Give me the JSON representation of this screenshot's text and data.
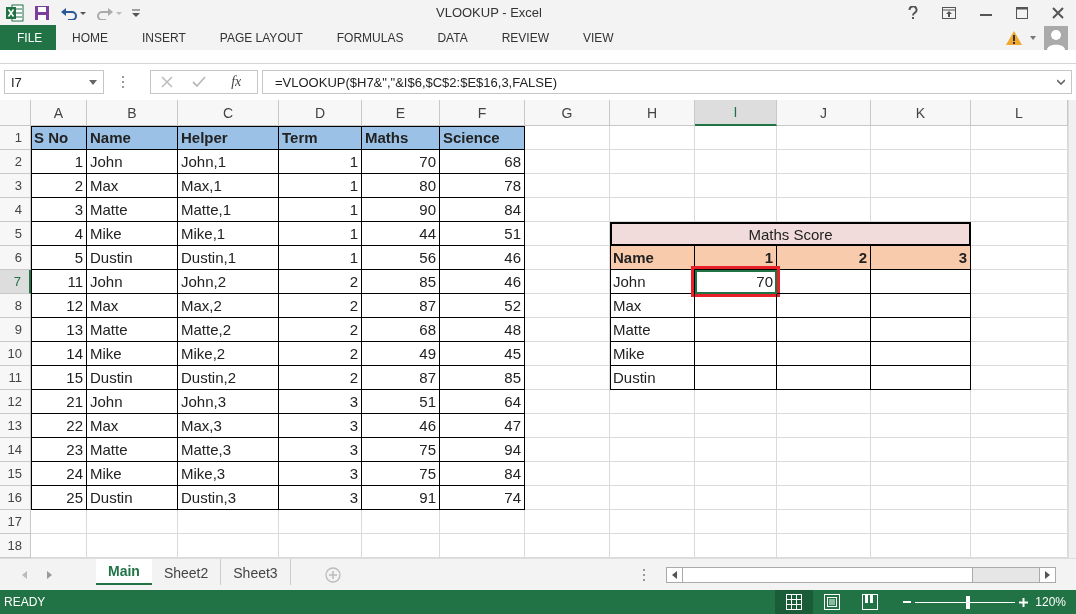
{
  "window": {
    "title": "VLOOKUP - Excel"
  },
  "ribbon_tabs": [
    {
      "label": "FILE",
      "kind": "file"
    },
    {
      "label": "HOME",
      "kind": "tab"
    },
    {
      "label": "INSERT",
      "kind": "tab"
    },
    {
      "label": "PAGE LAYOUT",
      "kind": "tab"
    },
    {
      "label": "FORMULAS",
      "kind": "tab"
    },
    {
      "label": "DATA",
      "kind": "tab"
    },
    {
      "label": "REVIEW",
      "kind": "tab"
    },
    {
      "label": "VIEW",
      "kind": "tab"
    }
  ],
  "formula_bar": {
    "name_box": "I7",
    "function_label": "fx",
    "formula": "=VLOOKUP($H7&\",\"&I$6,$C$2:$E$16,3,FALSE)"
  },
  "sheet": {
    "columns": [
      {
        "label": "A",
        "selected": false
      },
      {
        "label": "B",
        "selected": false
      },
      {
        "label": "C",
        "selected": false
      },
      {
        "label": "D",
        "selected": false
      },
      {
        "label": "E",
        "selected": false
      },
      {
        "label": "F",
        "selected": false
      },
      {
        "label": "G",
        "selected": false
      },
      {
        "label": "H",
        "selected": false
      },
      {
        "label": "I",
        "selected": true
      },
      {
        "label": "J",
        "selected": false
      },
      {
        "label": "K",
        "selected": false
      },
      {
        "label": "L",
        "selected": false
      }
    ],
    "rows": [
      {
        "label": "1",
        "selected": false
      },
      {
        "label": "2",
        "selected": false
      },
      {
        "label": "3",
        "selected": false
      },
      {
        "label": "4",
        "selected": false
      },
      {
        "label": "5",
        "selected": false
      },
      {
        "label": "6",
        "selected": false
      },
      {
        "label": "7",
        "selected": true
      },
      {
        "label": "8",
        "selected": false
      },
      {
        "label": "9",
        "selected": false
      },
      {
        "label": "10",
        "selected": false
      },
      {
        "label": "11",
        "selected": false
      },
      {
        "label": "12",
        "selected": false
      },
      {
        "label": "13",
        "selected": false
      },
      {
        "label": "14",
        "selected": false
      },
      {
        "label": "15",
        "selected": false
      },
      {
        "label": "16",
        "selected": false
      },
      {
        "label": "17",
        "selected": false
      },
      {
        "label": "18",
        "selected": false
      }
    ]
  },
  "source_table": {
    "columns": [
      {
        "label": "S No",
        "kind": "number"
      },
      {
        "label": "Name",
        "kind": "text"
      },
      {
        "label": "Helper",
        "kind": "text"
      },
      {
        "label": "Term",
        "kind": "number"
      },
      {
        "label": "Maths",
        "kind": "number"
      },
      {
        "label": "Science",
        "kind": "number"
      }
    ],
    "rows": [
      [
        "1",
        "John",
        "John,1",
        "1",
        "70",
        "68"
      ],
      [
        "2",
        "Max",
        "Max,1",
        "1",
        "80",
        "78"
      ],
      [
        "3",
        "Matte",
        "Matte,1",
        "1",
        "90",
        "84"
      ],
      [
        "4",
        "Mike",
        "Mike,1",
        "1",
        "44",
        "51"
      ],
      [
        "5",
        "Dustin",
        "Dustin,1",
        "1",
        "56",
        "46"
      ],
      [
        "11",
        "John",
        "John,2",
        "2",
        "85",
        "46"
      ],
      [
        "12",
        "Max",
        "Max,2",
        "2",
        "87",
        "52"
      ],
      [
        "13",
        "Matte",
        "Matte,2",
        "2",
        "68",
        "48"
      ],
      [
        "14",
        "Mike",
        "Mike,2",
        "2",
        "49",
        "45"
      ],
      [
        "15",
        "Dustin",
        "Dustin,2",
        "2",
        "87",
        "85"
      ],
      [
        "21",
        "John",
        "John,3",
        "3",
        "51",
        "64"
      ],
      [
        "22",
        "Max",
        "Max,3",
        "3",
        "46",
        "47"
      ],
      [
        "23",
        "Matte",
        "Matte,3",
        "3",
        "75",
        "94"
      ],
      [
        "24",
        "Mike",
        "Mike,3",
        "3",
        "75",
        "84"
      ],
      [
        "25",
        "Dustin",
        "Dustin,3",
        "3",
        "91",
        "74"
      ]
    ]
  },
  "score_table": {
    "title": "Maths Score",
    "header": [
      "Name",
      "1",
      "2",
      "3"
    ],
    "rows": [
      {
        "name": "John",
        "scores": [
          {
            "value": "70",
            "selected": true,
            "highlighted": true
          },
          {
            "selected": false,
            "highlighted": false
          },
          {
            "selected": false,
            "highlighted": false
          }
        ]
      },
      {
        "name": "Max",
        "scores": [
          {
            "selected": false,
            "highlighted": false
          },
          {
            "selected": false,
            "highlighted": false
          },
          {
            "selected": false,
            "highlighted": false
          }
        ]
      },
      {
        "name": "Matte",
        "scores": [
          {
            "selected": false,
            "highlighted": false
          },
          {
            "selected": false,
            "highlighted": false
          },
          {
            "selected": false,
            "highlighted": false
          }
        ]
      },
      {
        "name": "Mike",
        "scores": [
          {
            "selected": false,
            "highlighted": false
          },
          {
            "selected": false,
            "highlighted": false
          },
          {
            "selected": false,
            "highlighted": false
          }
        ]
      },
      {
        "name": "Dustin",
        "scores": [
          {
            "selected": false,
            "highlighted": false
          },
          {
            "selected": false,
            "highlighted": false
          },
          {
            "selected": false,
            "highlighted": false
          }
        ]
      }
    ]
  },
  "sheet_tabs": [
    {
      "label": "Main",
      "selected": true
    },
    {
      "label": "Sheet2",
      "selected": false
    },
    {
      "label": "Sheet3",
      "selected": false
    }
  ],
  "status_bar": {
    "status": "READY",
    "views": [
      {
        "kind": "normal",
        "selected": true
      },
      {
        "kind": "page-layout",
        "selected": false
      },
      {
        "kind": "page-break",
        "selected": false
      }
    ],
    "zoom": {
      "level": 0.53,
      "reading": "120%"
    }
  }
}
